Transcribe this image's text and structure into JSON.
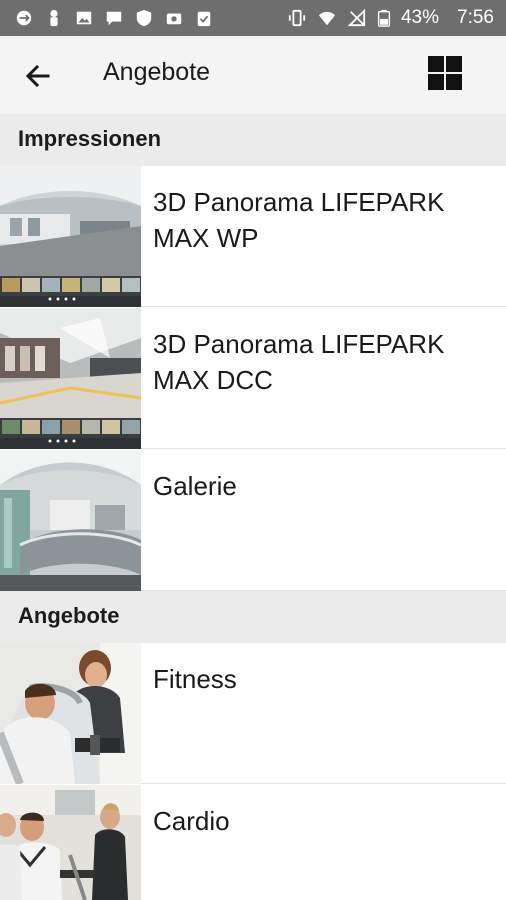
{
  "status_bar": {
    "battery_percent": "43%",
    "time": "7:56"
  },
  "app_bar": {
    "title": "Angebote",
    "back_icon": "arrow-back-icon",
    "view_toggle_icon": "grid-view-icon"
  },
  "sections": [
    {
      "header": "Impressionen",
      "items": [
        {
          "label": "3D Panorama LIFEPARK MAX WP",
          "thumbnail": "panorama-mall-thumbnail"
        },
        {
          "label": "3D Panorama LIFEPARK MAX DCC",
          "thumbnail": "panorama-store-thumbnail"
        },
        {
          "label": "Galerie",
          "thumbnail": "gallery-reception-thumbnail"
        }
      ]
    },
    {
      "header": "Angebote",
      "items": [
        {
          "label": "Fitness",
          "thumbnail": "fitness-photo-thumbnail"
        },
        {
          "label": "Cardio",
          "thumbnail": "cardio-photo-thumbnail"
        }
      ]
    }
  ],
  "colors": {
    "status_bar": "#6e6e6e",
    "app_bar": "#f4f4f4",
    "section_header": "#ebebeb",
    "text": "#1a1a1a"
  }
}
